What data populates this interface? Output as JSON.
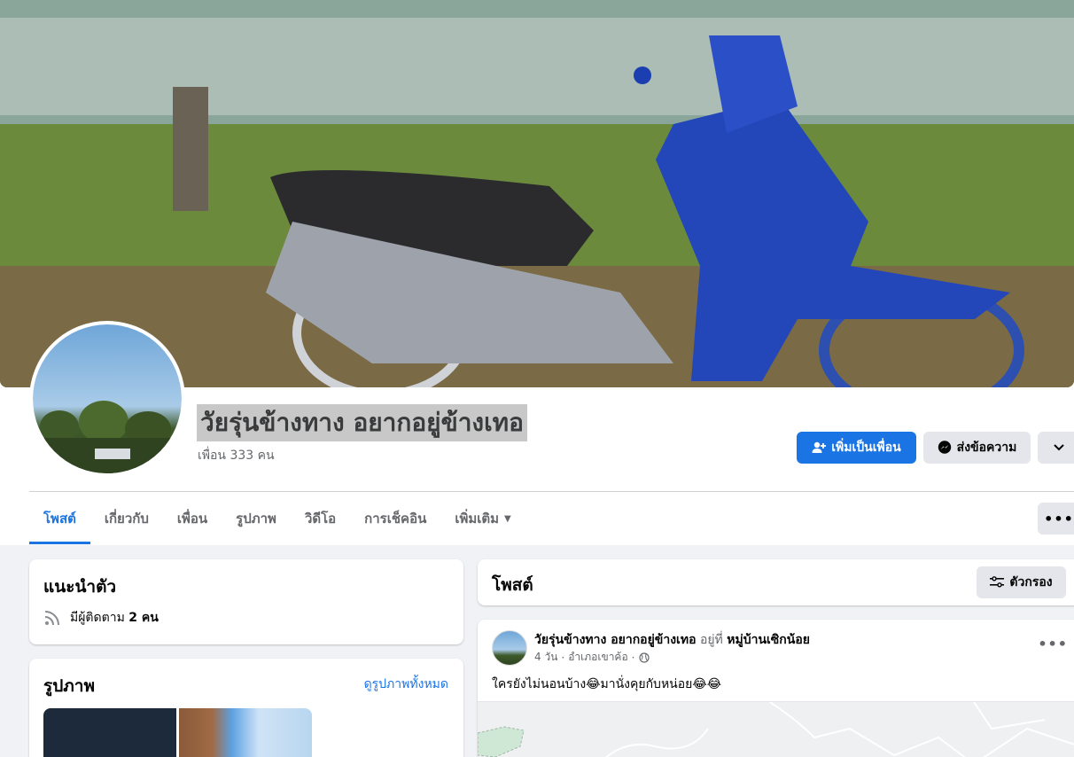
{
  "profile": {
    "name": "วัยรุ่นข้างทาง อยากอยู่ข้างเทอ",
    "friends": "เพื่อน 333 คน"
  },
  "actions": {
    "add_friend": "เพิ่มเป็นเพื่อน",
    "message": "ส่งข้อความ"
  },
  "tabs": [
    {
      "label": "โพสต์",
      "active": true
    },
    {
      "label": "เกี่ยวกับ"
    },
    {
      "label": "เพื่อน"
    },
    {
      "label": "รูปภาพ"
    },
    {
      "label": "วิดีโอ"
    },
    {
      "label": "การเช็คอิน"
    },
    {
      "label": "เพิ่มเติม"
    }
  ],
  "intro": {
    "title": "แนะนำตัว",
    "followers_prefix": "มีผู้ติดตาม",
    "followers_count": "2 คน"
  },
  "photos": {
    "title": "รูปภาพ",
    "see_all": "ดูรูปภาพทั้งหมด"
  },
  "posts": {
    "title": "โพสต์",
    "filter": "ตัวกรอง"
  },
  "post": {
    "author": "วัยรุ่นข้างทาง อยากอยู่ข้างเทอ",
    "at_word": "อยู่ที่",
    "place": "หมู่บ้านเซิกน้อย",
    "time": "4 วัน",
    "location": "อำเภอเขาค้อ",
    "text": "ใครยังไม่นอนบ้าง😂มานั่งคุยกับหน่อย😂😂"
  },
  "colors": {
    "accent": "#1b74e4",
    "background": "#f0f2f5"
  }
}
